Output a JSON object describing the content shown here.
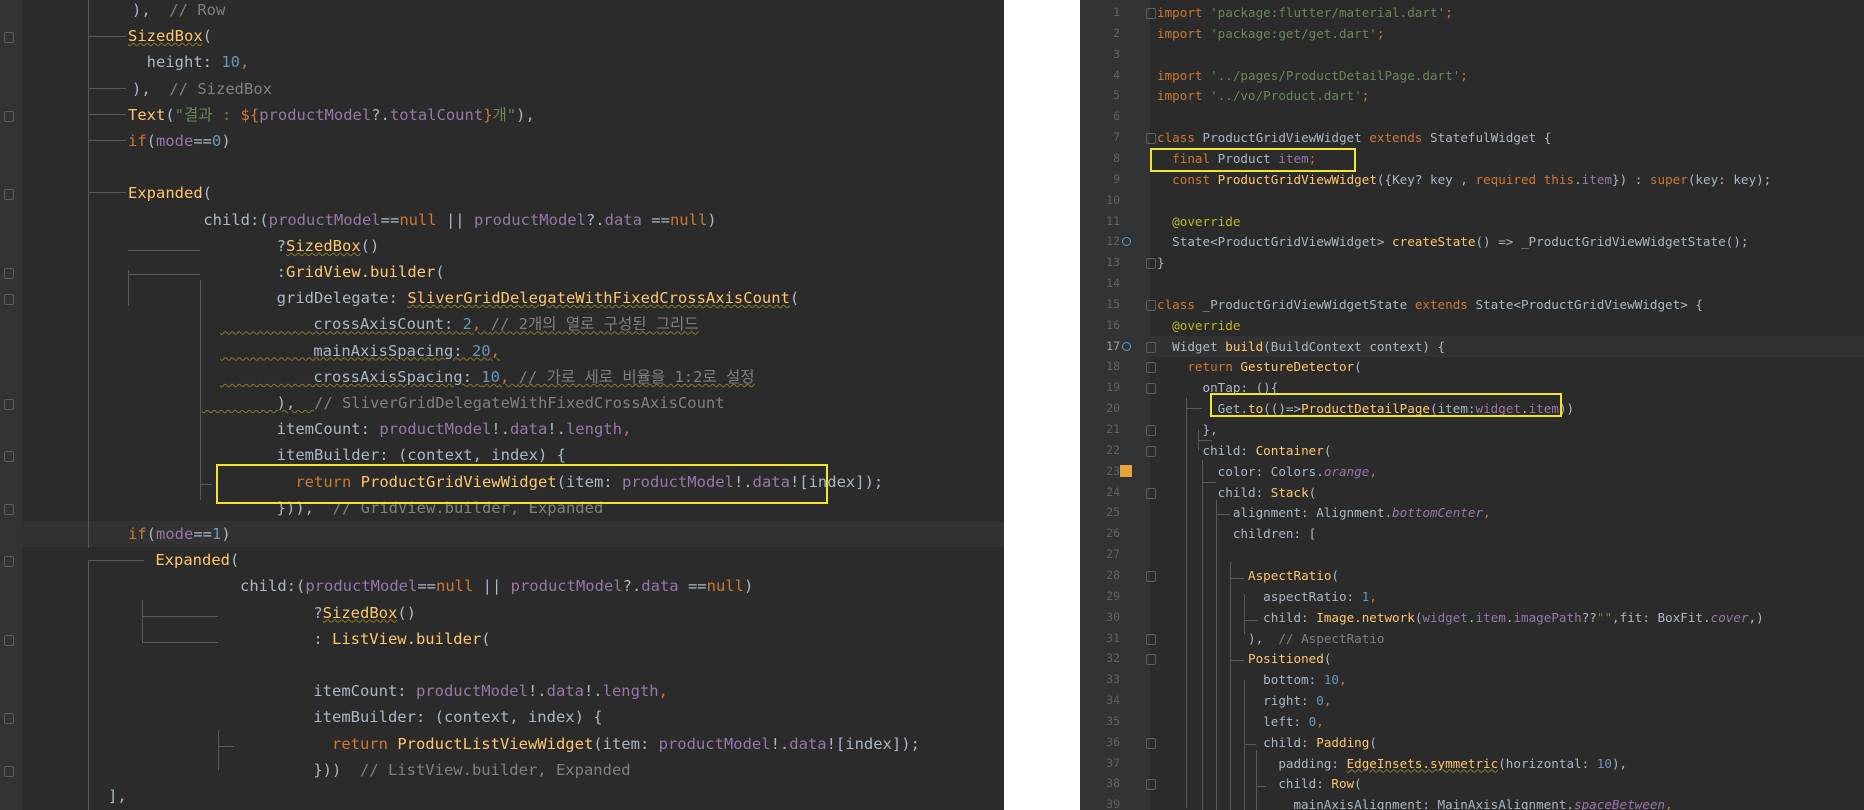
{
  "colors": {
    "background": "#2b2b2b",
    "gutter": "#313335",
    "text": "#a9b7c6",
    "keyword": "#cc7832",
    "function": "#ffc66d",
    "field": "#9876aa",
    "string": "#6a8759",
    "number": "#6897bb",
    "comment": "#808080",
    "annotation": "#bbb529",
    "highlight_box": "#f3e32b"
  },
  "left_editor": {
    "lines": [
      [
        {
          "t": "),  ",
          "c": "text"
        },
        {
          "t": "// Row",
          "c": "comment"
        }
      ],
      [
        {
          "t": "SizedBox",
          "c": "function",
          "u": true
        },
        {
          "t": "(",
          "c": "text"
        }
      ],
      [
        {
          "t": "  height: ",
          "c": "text"
        },
        {
          "t": "10",
          "c": "number"
        },
        {
          "t": ",",
          "c": "keyword"
        }
      ],
      [
        {
          "t": "),  ",
          "c": "text"
        },
        {
          "t": "// SizedBox",
          "c": "comment"
        }
      ],
      [
        {
          "t": "Text",
          "c": "function"
        },
        {
          "t": "(",
          "c": "text"
        },
        {
          "t": "\"결과 : ",
          "c": "string"
        },
        {
          "t": "${",
          "c": "keyword"
        },
        {
          "t": "productModel",
          "c": "field"
        },
        {
          "t": "?.",
          "c": "text"
        },
        {
          "t": "totalCount",
          "c": "field"
        },
        {
          "t": "}",
          "c": "keyword"
        },
        {
          "t": "개\"",
          "c": "string"
        },
        {
          "t": "),",
          "c": "text"
        }
      ],
      [
        {
          "t": "if",
          "c": "keyword"
        },
        {
          "t": "(",
          "c": "text"
        },
        {
          "t": "mode",
          "c": "field"
        },
        {
          "t": "==",
          "c": "text"
        },
        {
          "t": "0",
          "c": "number"
        },
        {
          "t": ")",
          "c": "text"
        }
      ],
      [],
      [
        {
          "t": "Expanded",
          "c": "function"
        },
        {
          "t": "(",
          "c": "text"
        }
      ],
      [
        {
          "t": "    child:(",
          "c": "text"
        },
        {
          "t": "productModel",
          "c": "field"
        },
        {
          "t": "==",
          "c": "text"
        },
        {
          "t": "null",
          "c": "keyword"
        },
        {
          "t": " || ",
          "c": "text"
        },
        {
          "t": "productModel",
          "c": "field"
        },
        {
          "t": "?.",
          "c": "text"
        },
        {
          "t": "data",
          "c": "field"
        },
        {
          "t": " ==",
          "c": "text"
        },
        {
          "t": "null",
          "c": "keyword"
        },
        {
          "t": ")",
          "c": "text"
        }
      ],
      [
        {
          "t": "        ?",
          "c": "text"
        },
        {
          "t": "SizedBox",
          "c": "function",
          "u": true
        },
        {
          "t": "()",
          "c": "text"
        }
      ],
      [
        {
          "t": "        :",
          "c": "text"
        },
        {
          "t": "GridView.builder",
          "c": "function"
        },
        {
          "t": "(",
          "c": "text"
        }
      ],
      [
        {
          "t": "        gridDelegate: ",
          "c": "text"
        },
        {
          "t": "SliverGridDelegateWithFixedCrossAxisCount",
          "c": "function",
          "u": true
        },
        {
          "t": "(",
          "c": "text"
        }
      ],
      [
        {
          "t": "          crossAxisCount: ",
          "c": "text",
          "u": true
        },
        {
          "t": "2",
          "c": "number",
          "u": true
        },
        {
          "t": ", ",
          "c": "keyword",
          "u": true
        },
        {
          "t": "// 2개의 열로 구성된 그리드",
          "c": "comment",
          "u": true
        }
      ],
      [
        {
          "t": "          mainAxisSpacing: ",
          "c": "text",
          "u": true
        },
        {
          "t": "20",
          "c": "number",
          "u": true
        },
        {
          "t": ",",
          "c": "keyword",
          "u": true
        }
      ],
      [
        {
          "t": "          crossAxisSpacing: ",
          "c": "text",
          "u": true
        },
        {
          "t": "10",
          "c": "number",
          "u": true
        },
        {
          "t": ", ",
          "c": "keyword",
          "u": true
        },
        {
          "t": "// 가로 세로 비율을 1:2로 설정",
          "c": "comment",
          "u": true
        }
      ],
      [
        {
          "t": "        ),  ",
          "c": "text",
          "u": true
        },
        {
          "t": "// SliverGridDelegateWithFixedCrossAxisCount",
          "c": "comment"
        }
      ],
      [
        {
          "t": "        itemCount: ",
          "c": "text"
        },
        {
          "t": "productModel",
          "c": "field"
        },
        {
          "t": "!.",
          "c": "text"
        },
        {
          "t": "data",
          "c": "field"
        },
        {
          "t": "!.",
          "c": "text"
        },
        {
          "t": "length",
          "c": "field"
        },
        {
          "t": ",",
          "c": "keyword"
        }
      ],
      [
        {
          "t": "        itemBuilder: (context, index) {",
          "c": "text"
        }
      ],
      [
        {
          "t": "          ",
          "c": "text"
        },
        {
          "t": "return ",
          "c": "keyword"
        },
        {
          "t": "ProductGridViewWidget",
          "c": "function"
        },
        {
          "t": "(item: ",
          "c": "text"
        },
        {
          "t": "productModel",
          "c": "field"
        },
        {
          "t": "!.",
          "c": "text"
        },
        {
          "t": "data",
          "c": "field"
        },
        {
          "t": "![index]);",
          "c": "text"
        }
      ],
      [
        {
          "t": "        })),  ",
          "c": "text"
        },
        {
          "t": "// GridView.builder, Expanded",
          "c": "comment"
        }
      ],
      [
        {
          "t": "if",
          "c": "keyword"
        },
        {
          "t": "(",
          "c": "text"
        },
        {
          "t": "mode",
          "c": "field"
        },
        {
          "t": "==",
          "c": "text"
        },
        {
          "t": "1",
          "c": "number"
        },
        {
          "t": ")",
          "c": "text"
        }
      ],
      [
        {
          "t": " Expanded",
          "c": "function"
        },
        {
          "t": "(",
          "c": "text"
        }
      ],
      [
        {
          "t": "      child:(",
          "c": "text"
        },
        {
          "t": "productModel",
          "c": "field"
        },
        {
          "t": "==",
          "c": "text"
        },
        {
          "t": "null",
          "c": "keyword"
        },
        {
          "t": " || ",
          "c": "text"
        },
        {
          "t": "productModel",
          "c": "field"
        },
        {
          "t": "?.",
          "c": "text"
        },
        {
          "t": "data",
          "c": "field"
        },
        {
          "t": " ==",
          "c": "text"
        },
        {
          "t": "null",
          "c": "keyword"
        },
        {
          "t": ")",
          "c": "text"
        }
      ],
      [
        {
          "t": "          ?",
          "c": "text"
        },
        {
          "t": "SizedBox",
          "c": "function",
          "u": true
        },
        {
          "t": "()",
          "c": "text"
        }
      ],
      [
        {
          "t": "          : ",
          "c": "text"
        },
        {
          "t": "ListView.builder",
          "c": "function"
        },
        {
          "t": "(",
          "c": "text"
        }
      ],
      [],
      [
        {
          "t": "          itemCount: ",
          "c": "text"
        },
        {
          "t": "productModel",
          "c": "field"
        },
        {
          "t": "!.",
          "c": "text"
        },
        {
          "t": "data",
          "c": "field"
        },
        {
          "t": "!.",
          "c": "text"
        },
        {
          "t": "length",
          "c": "field"
        },
        {
          "t": ",",
          "c": "keyword"
        }
      ],
      [
        {
          "t": "          itemBuilder: (context, index) {",
          "c": "text"
        }
      ],
      [
        {
          "t": "            ",
          "c": "text"
        },
        {
          "t": "return ",
          "c": "keyword"
        },
        {
          "t": "ProductListViewWidget",
          "c": "function"
        },
        {
          "t": "(item: ",
          "c": "text"
        },
        {
          "t": "productModel",
          "c": "field"
        },
        {
          "t": "!.",
          "c": "text"
        },
        {
          "t": "data",
          "c": "field"
        },
        {
          "t": "![index]);",
          "c": "text"
        }
      ],
      [
        {
          "t": "          }))  ",
          "c": "text"
        },
        {
          "t": "// ListView.builder, Expanded",
          "c": "comment"
        }
      ],
      [
        {
          "t": "],",
          "c": "text"
        }
      ]
    ]
  },
  "right_editor": {
    "current_line": 17,
    "lines": [
      [
        {
          "t": "import ",
          "c": "keyword"
        },
        {
          "t": "'package:flutter/material.dart'",
          "c": "string"
        },
        {
          "t": ";",
          "c": "keyword"
        }
      ],
      [
        {
          "t": "import ",
          "c": "keyword"
        },
        {
          "t": "'package:get/get.dart'",
          "c": "string"
        },
        {
          "t": ";",
          "c": "keyword"
        }
      ],
      [],
      [
        {
          "t": "import ",
          "c": "keyword"
        },
        {
          "t": "'../pages/ProductDetailPage.dart'",
          "c": "string"
        },
        {
          "t": ";",
          "c": "keyword"
        }
      ],
      [
        {
          "t": "import ",
          "c": "keyword"
        },
        {
          "t": "'../vo/Product.dart'",
          "c": "string"
        },
        {
          "t": ";",
          "c": "keyword"
        }
      ],
      [],
      [
        {
          "t": "class ",
          "c": "keyword"
        },
        {
          "t": "ProductGridViewWidget ",
          "c": "text"
        },
        {
          "t": "extends ",
          "c": "keyword"
        },
        {
          "t": "StatefulWidget {",
          "c": "text"
        }
      ],
      [
        {
          "t": "  final ",
          "c": "keyword"
        },
        {
          "t": "Product ",
          "c": "text"
        },
        {
          "t": "item",
          "c": "field"
        },
        {
          "t": ";",
          "c": "keyword"
        }
      ],
      [
        {
          "t": "  const ",
          "c": "keyword"
        },
        {
          "t": "ProductGridViewWidget",
          "c": "function"
        },
        {
          "t": "({Key? key , ",
          "c": "text"
        },
        {
          "t": "required this",
          "c": "keyword"
        },
        {
          "t": ".",
          "c": "text"
        },
        {
          "t": "item",
          "c": "field"
        },
        {
          "t": "}) : ",
          "c": "text"
        },
        {
          "t": "super",
          "c": "keyword"
        },
        {
          "t": "(key: key);",
          "c": "text"
        }
      ],
      [],
      [
        {
          "t": "  @override",
          "c": "annotation"
        }
      ],
      [
        {
          "t": "  State<ProductGridViewWidget> ",
          "c": "text"
        },
        {
          "t": "createState",
          "c": "function"
        },
        {
          "t": "() => _ProductGridViewWidgetState();",
          "c": "text"
        }
      ],
      [
        {
          "t": "}",
          "c": "text"
        }
      ],
      [],
      [
        {
          "t": "class ",
          "c": "keyword"
        },
        {
          "t": "_ProductGridViewWidgetState ",
          "c": "text"
        },
        {
          "t": "extends ",
          "c": "keyword"
        },
        {
          "t": "State<ProductGridViewWidget> {",
          "c": "text"
        }
      ],
      [
        {
          "t": "  @override",
          "c": "annotation"
        }
      ],
      [
        {
          "t": "  Widget ",
          "c": "text"
        },
        {
          "t": "build",
          "c": "function"
        },
        {
          "t": "(BuildContext context) {",
          "c": "text"
        }
      ],
      [
        {
          "t": "    return ",
          "c": "keyword"
        },
        {
          "t": "GestureDetector",
          "c": "function"
        },
        {
          "t": "(",
          "c": "text"
        }
      ],
      [
        {
          "t": "      onTap: (){",
          "c": "text"
        }
      ],
      [
        {
          "t": "        Get.",
          "c": "text"
        },
        {
          "t": "to",
          "c": "function"
        },
        {
          "t": "(()=>",
          "c": "text"
        },
        {
          "t": "ProductDetailPage",
          "c": "function"
        },
        {
          "t": "(item:",
          "c": "text"
        },
        {
          "t": "widget",
          "c": "field"
        },
        {
          "t": ".",
          "c": "text"
        },
        {
          "t": "item",
          "c": "field"
        },
        {
          "t": "))",
          "c": "text"
        }
      ],
      [
        {
          "t": "      },",
          "c": "text"
        }
      ],
      [
        {
          "t": "      child: ",
          "c": "text"
        },
        {
          "t": "Container",
          "c": "function"
        },
        {
          "t": "(",
          "c": "text"
        }
      ],
      [
        {
          "t": "        color: Colors.",
          "c": "text"
        },
        {
          "t": "orange",
          "c": "field",
          "i": true
        },
        {
          "t": ",",
          "c": "keyword"
        }
      ],
      [
        {
          "t": "        child: ",
          "c": "text"
        },
        {
          "t": "Stack",
          "c": "function"
        },
        {
          "t": "(",
          "c": "text"
        }
      ],
      [
        {
          "t": "          alignment: Alignment.",
          "c": "text"
        },
        {
          "t": "bottomCenter",
          "c": "field",
          "i": true
        },
        {
          "t": ",",
          "c": "keyword"
        }
      ],
      [
        {
          "t": "          children: [",
          "c": "text"
        }
      ],
      [],
      [
        {
          "t": "            ",
          "c": "text"
        },
        {
          "t": "AspectRatio",
          "c": "function"
        },
        {
          "t": "(",
          "c": "text"
        }
      ],
      [
        {
          "t": "              aspectRatio: ",
          "c": "text"
        },
        {
          "t": "1",
          "c": "number"
        },
        {
          "t": ",",
          "c": "keyword"
        }
      ],
      [
        {
          "t": "              child: ",
          "c": "text"
        },
        {
          "t": "Image.network",
          "c": "function"
        },
        {
          "t": "(",
          "c": "text"
        },
        {
          "t": "widget",
          "c": "field"
        },
        {
          "t": ".",
          "c": "text"
        },
        {
          "t": "item",
          "c": "field"
        },
        {
          "t": ".",
          "c": "text"
        },
        {
          "t": "imagePath",
          "c": "field"
        },
        {
          "t": "??",
          "c": "text"
        },
        {
          "t": "\"\"",
          "c": "string"
        },
        {
          "t": ",fit: BoxFit.",
          "c": "text"
        },
        {
          "t": "cover",
          "c": "field",
          "i": true
        },
        {
          "t": ",)",
          "c": "text"
        }
      ],
      [
        {
          "t": "            ),  ",
          "c": "text"
        },
        {
          "t": "// AspectRatio",
          "c": "comment"
        }
      ],
      [
        {
          "t": "            ",
          "c": "text"
        },
        {
          "t": "Positioned",
          "c": "function"
        },
        {
          "t": "(",
          "c": "text"
        }
      ],
      [
        {
          "t": "              bottom: ",
          "c": "text"
        },
        {
          "t": "10",
          "c": "number"
        },
        {
          "t": ",",
          "c": "keyword"
        }
      ],
      [
        {
          "t": "              right: ",
          "c": "text"
        },
        {
          "t": "0",
          "c": "number"
        },
        {
          "t": ",",
          "c": "keyword"
        }
      ],
      [
        {
          "t": "              left: ",
          "c": "text"
        },
        {
          "t": "0",
          "c": "number"
        },
        {
          "t": ",",
          "c": "keyword"
        }
      ],
      [
        {
          "t": "              child: ",
          "c": "text"
        },
        {
          "t": "Padding",
          "c": "function"
        },
        {
          "t": "(",
          "c": "text"
        }
      ],
      [
        {
          "t": "                padding: ",
          "c": "text"
        },
        {
          "t": "EdgeInsets.symmetric",
          "c": "function",
          "u": true
        },
        {
          "t": "(horizontal: ",
          "c": "text"
        },
        {
          "t": "10",
          "c": "number"
        },
        {
          "t": "),",
          "c": "text"
        }
      ],
      [
        {
          "t": "                child: ",
          "c": "text"
        },
        {
          "t": "Row",
          "c": "function"
        },
        {
          "t": "(",
          "c": "text"
        }
      ],
      [
        {
          "t": "                  mainAxisAlignment: MainAxisAlignment.",
          "c": "text"
        },
        {
          "t": "spaceBetween",
          "c": "field",
          "i": true
        },
        {
          "t": ",",
          "c": "keyword"
        }
      ]
    ]
  }
}
